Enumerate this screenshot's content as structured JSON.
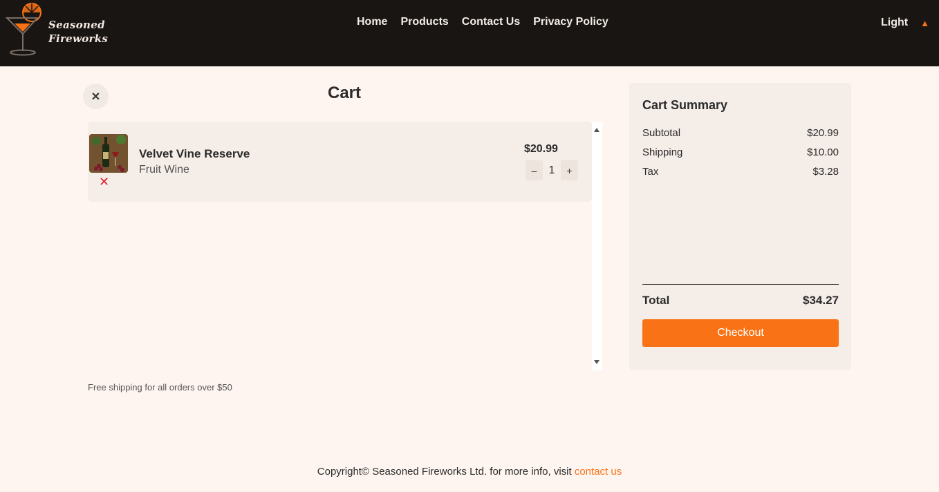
{
  "header": {
    "logo_line1": "Seasoned",
    "logo_line2": "Fireworks",
    "nav": [
      {
        "label": "Home"
      },
      {
        "label": "Products"
      },
      {
        "label": "Contact Us"
      },
      {
        "label": "Privacy Policy"
      }
    ],
    "theme_label": "Light",
    "theme_icon": "▲"
  },
  "cart": {
    "close_icon": "✕",
    "title": "Cart",
    "items": [
      {
        "name": "Velvet Vine Reserve",
        "category": "Fruit Wine",
        "price": "$20.99",
        "quantity": "1",
        "decrement": "–",
        "increment": "+",
        "remove_icon": "✕"
      }
    ],
    "note": "Free shipping for all orders over $50"
  },
  "summary": {
    "title": "Cart Summary",
    "subtotal_label": "Subtotal",
    "subtotal_value": "$20.99",
    "shipping_label": "Shipping",
    "shipping_value": "$10.00",
    "tax_label": "Tax",
    "tax_value": "$3.28",
    "total_label": "Total",
    "total_value": "$34.27",
    "checkout_label": "Checkout"
  },
  "footer": {
    "text": "Copyright© Seasoned Fireworks Ltd. for more info, visit ",
    "link": "contact us"
  },
  "colors": {
    "accent": "#f97316",
    "header_bg": "#181512",
    "page_bg": "#fff5f0",
    "remove": "#e11d2e"
  }
}
